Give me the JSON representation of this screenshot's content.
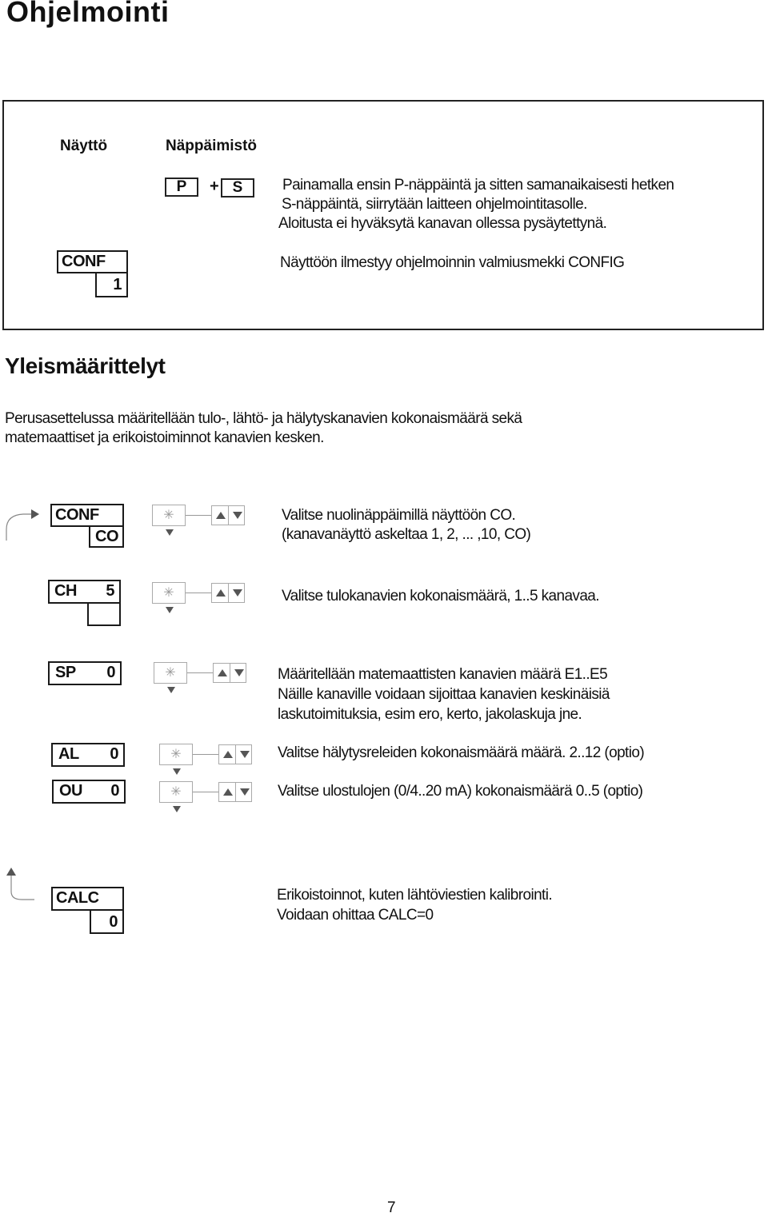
{
  "page": {
    "title": "Ohjelmointi",
    "page_number": "7"
  },
  "intro_box": {
    "col_display": "Näyttö",
    "col_keypad": "Näppäimistö",
    "key_p": "P",
    "key_plus": "+",
    "key_s": "S",
    "keys_text": [
      "Painamalla ensin P-näppäintä ja sitten samanaikaisesti hetken",
      "S-näppäintä, siirrytään laitteen ohjelmointitasolle.",
      "Aloitusta ei hyväksytä  kanavan ollessa pysäytettynä."
    ],
    "display_top": "CONF",
    "display_bottom": "1",
    "display_text": "Näyttöön ilmestyy ohjelmoinnin valmiusmekki CONFIG"
  },
  "section": {
    "heading": "Yleismäärittelyt",
    "paragraph": [
      "Perusasettelussa määritellään  tulo-, lähtö- ja hälytyskanavien kokonaismäärä sekä",
      "matemaattiset ja erikoistoiminnot kanavien kesken."
    ]
  },
  "steps": [
    {
      "display_left": "CONF",
      "display_sub": "CO",
      "text": [
        "Valitse nuolinäppäimillä näyttöön CO.",
        "(kanavanäyttö askeltaa  1, 2, ... ,10, CO)"
      ]
    },
    {
      "display_left": "CH",
      "display_right": "5",
      "display_sub": "",
      "text": [
        "Valitse tulokanavien kokonaismäärä, 1..5 kanavaa."
      ]
    },
    {
      "display_left": "SP",
      "display_right": "0",
      "text": [
        "Määritellään matemaattisten kanavien määrä E1..E5",
        "Näille kanaville voidaan sijoittaa kanavien keskinäisiä",
        "laskutoimituksia, esim ero, kerto, jakolaskuja jne."
      ]
    },
    {
      "display_left": "AL",
      "display_right": "0",
      "text": [
        "Valitse hälytysreleiden kokonaismäärä määrä. 2..12 (optio)"
      ]
    },
    {
      "display_left": "OU",
      "display_right": "0",
      "text": [
        "Valitse ulostulojen (0/4..20 mA) kokonaismäärä 0..5 (optio)"
      ]
    },
    {
      "display_left": "CALC",
      "display_sub": "0",
      "text": [
        "Erikoistoinnot, kuten lähtöviestien kalibrointi.",
        "Voidaan ohittaa CALC=0"
      ]
    }
  ],
  "icons": {
    "set_key": "✳"
  }
}
